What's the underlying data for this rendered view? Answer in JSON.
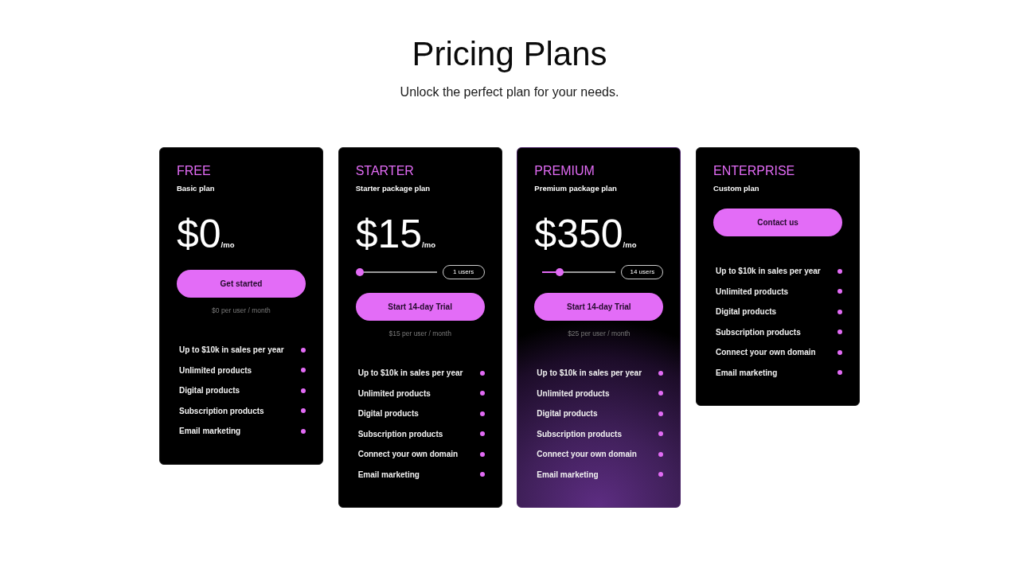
{
  "header": {
    "title": "Pricing Plans",
    "subtitle": "Unlock the perfect plan for your needs."
  },
  "plans": [
    {
      "name": "FREE",
      "description": "Basic plan",
      "featured": false,
      "price": {
        "amount": "$0",
        "period": "/mo"
      },
      "button": "Get started",
      "note": "$0 per user / month",
      "features": [
        "Up to $10k in sales per year",
        "Unlimited products",
        "Digital products",
        "Subscription products",
        "Email marketing"
      ]
    },
    {
      "name": "STARTER",
      "description": "Starter package plan",
      "featured": false,
      "price": {
        "amount": "$15",
        "period": "/mo"
      },
      "users": {
        "level": 0,
        "label": "1 users"
      },
      "button": "Start 14-day Trial",
      "note": "$15 per user / month",
      "features": [
        "Up to $10k in sales per year",
        "Unlimited products",
        "Digital products",
        "Subscription products",
        "Connect your own domain",
        "Email marketing"
      ]
    },
    {
      "name": "PREMIUM",
      "description": "Premium package plan",
      "featured": true,
      "price": {
        "amount": "$350",
        "period": "/mo"
      },
      "users": {
        "level": 0.29,
        "label": "14 users"
      },
      "button": "Start 14-day Trial",
      "note": "$25 per user / month",
      "features": [
        "Up to $10k in sales per year",
        "Unlimited products",
        "Digital products",
        "Subscription products",
        "Connect your own domain",
        "Email marketing"
      ]
    },
    {
      "name": "ENTERPRISE",
      "description": "Custom plan",
      "featured": false,
      "button": "Contact us",
      "features": [
        "Up to $10k in sales per year",
        "Unlimited products",
        "Digital products",
        "Subscription products",
        "Connect your own domain",
        "Email marketing"
      ]
    }
  ]
}
